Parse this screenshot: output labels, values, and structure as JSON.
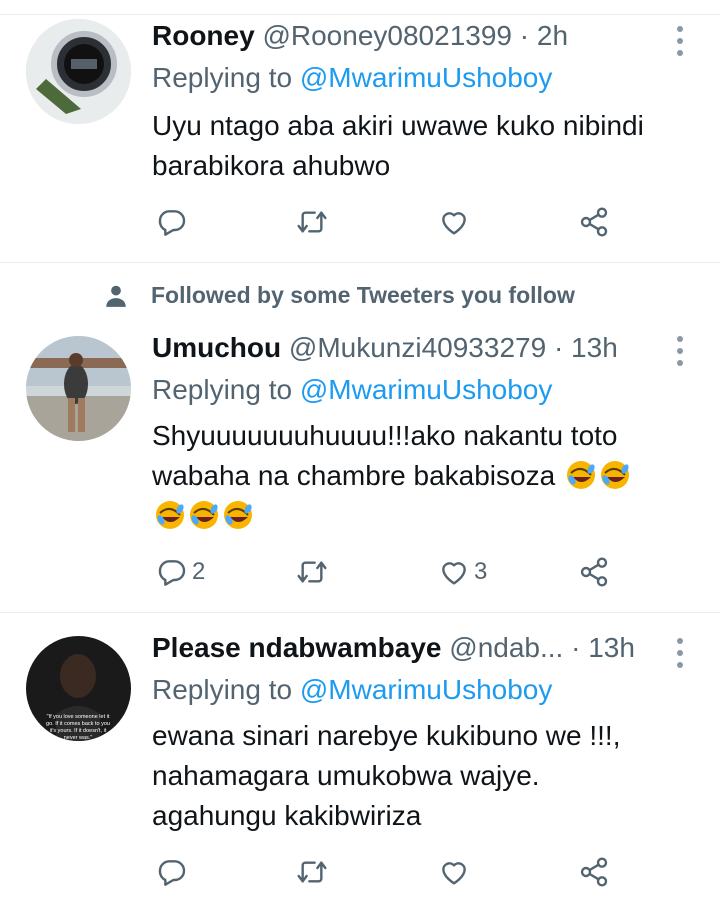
{
  "tweets": [
    {
      "name": "Rooney",
      "handle": "@Rooney08021399",
      "separator": "·",
      "time": "2h",
      "replying_prefix": "Replying to",
      "replying_to": "@MwarimuUshoboy",
      "text_lines": [
        "Uyu ntago aba akiri uwawe kuko nibindi",
        "barabikora ahubwo"
      ],
      "avatar": "watch-photo",
      "actions": {
        "reply_count": "",
        "retweet_count": "",
        "like_count": ""
      }
    },
    {
      "social_context": "Followed by some Tweeters you follow",
      "name": "Umuchou",
      "handle": "@Mukunzi40933279",
      "separator": "·",
      "time": "13h",
      "replying_prefix": "Replying to",
      "replying_to": "@MwarimuUshoboy",
      "text_lines": [
        "Shyuuuuuuuhuuuu!!!ako nakantu toto",
        "wabaha na chambre bakabisoza"
      ],
      "emoji": "rolling-on-floor-laughing",
      "avatar": "woman-photo",
      "actions": {
        "reply_count": "2",
        "retweet_count": "",
        "like_count": "3"
      }
    },
    {
      "name": "Please ndabwambaye",
      "handle": "@ndab...",
      "separator": "·",
      "time": "13h",
      "replying_prefix": "Replying to",
      "replying_to": "@MwarimuUshoboy",
      "text_lines": [
        "ewana sinari narebye kukibuno we !!!,",
        "nahamagara umukobwa wajye.",
        "agahungu kakibwiriza"
      ],
      "avatar": "quote-portrait-photo",
      "avatar_caption": "\"If you love someone let it go. If it comes back to you it's yours. If it doesn't, it never was.\"",
      "actions": {
        "reply_count": "",
        "retweet_count": "",
        "like_count": ""
      }
    }
  ],
  "colors": {
    "accent": "#1d9bf0",
    "secondary_text": "#536471",
    "divider": "#e6ecf0"
  }
}
